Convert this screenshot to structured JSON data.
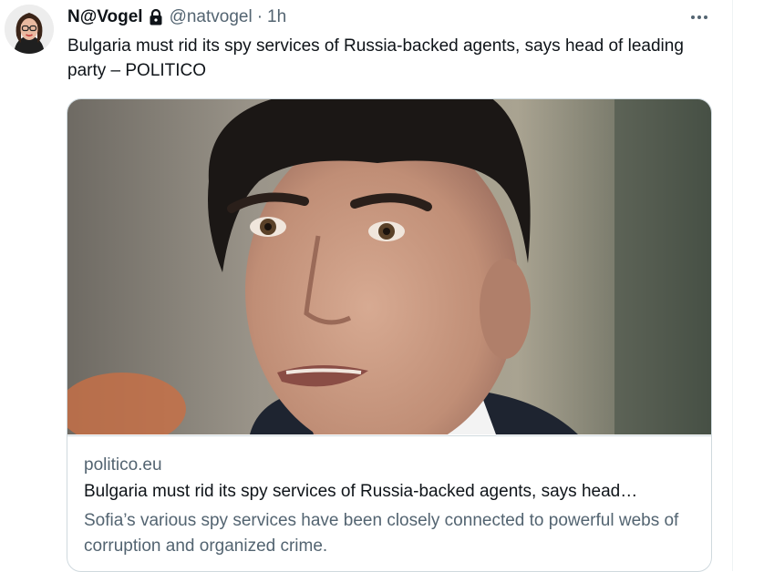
{
  "tweet": {
    "display_name": "N@Vogel",
    "handle": "@natvogel",
    "separator": "·",
    "time": "1h",
    "text": "Bulgaria must rid its spy services of Russia-backed agents, says head of leading party – POLITICO",
    "protected_icon": "lock-icon",
    "more_icon": "more-horizontal-icon",
    "avatar_icon": "profile-photo"
  },
  "card": {
    "domain": "politico.eu",
    "title": "Bulgaria must rid its spy services of Russia-backed agents, says head…",
    "description": "Sofia’s various spy services have been closely connected to powerful webs of corruption and organized crime."
  },
  "colors": {
    "text_primary": "#0f1419",
    "text_secondary": "#536471",
    "border": "#cfd9de"
  }
}
